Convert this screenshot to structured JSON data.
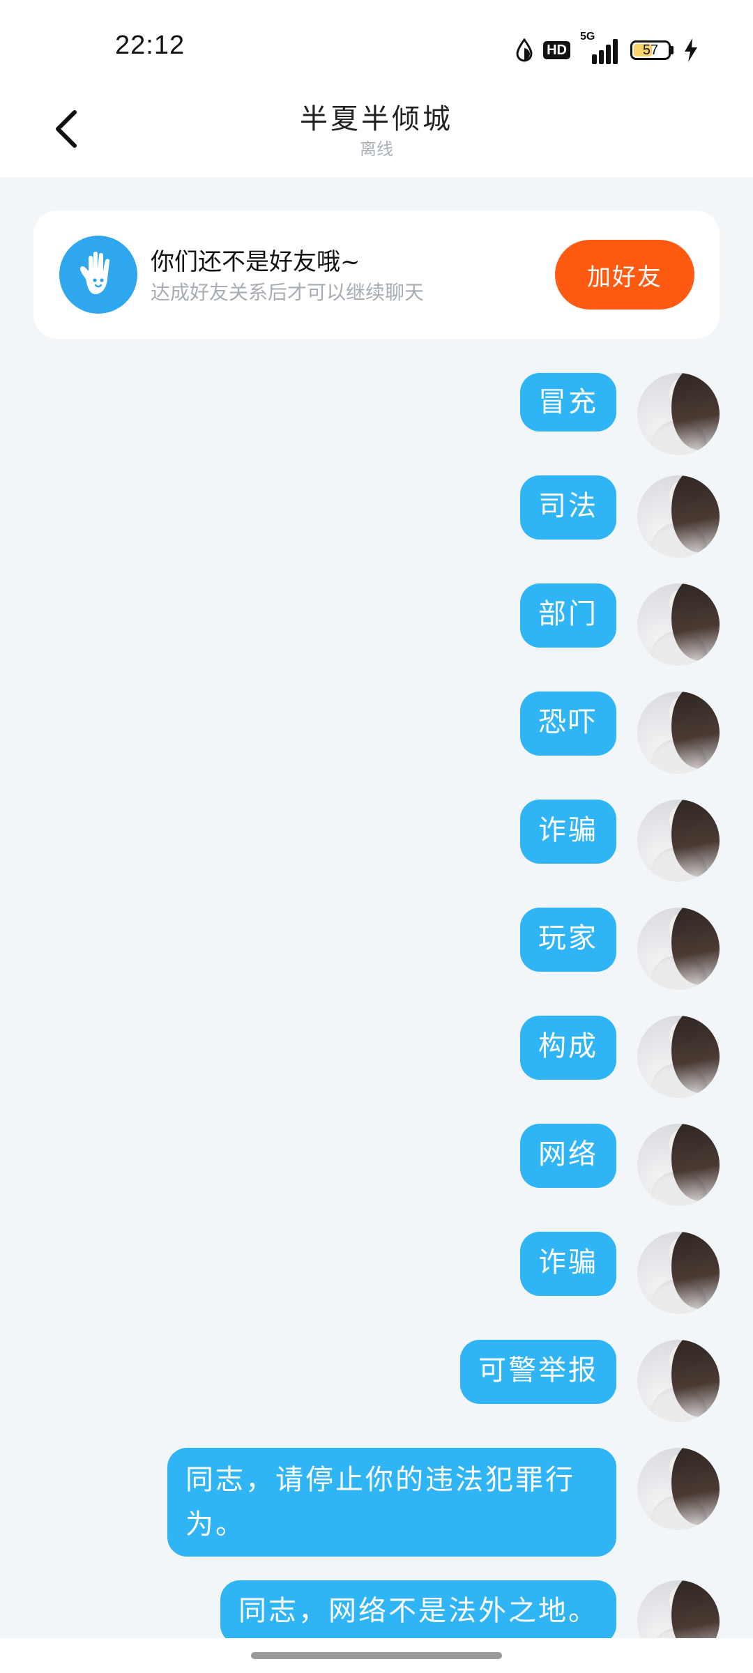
{
  "status_bar": {
    "time": "22:12",
    "hd": "HD",
    "network": "5G",
    "battery": "57",
    "battery_level": 0.57
  },
  "header": {
    "back_icon": "chevron-left-icon",
    "title": "半夏半倾城",
    "status": "离线"
  },
  "friend_card": {
    "icon": "waving-hand-icon",
    "title": "你们还不是好友哦~",
    "subtitle": "达成好友关系后才可以继续聊天",
    "button": "加好友",
    "button_color": "#ff5a12"
  },
  "messages": [
    {
      "text": "冒充"
    },
    {
      "text": "司法"
    },
    {
      "text": "部门"
    },
    {
      "text": "恐吓"
    },
    {
      "text": "诈骗"
    },
    {
      "text": "玩家"
    },
    {
      "text": "构成"
    },
    {
      "text": "网络"
    },
    {
      "text": "诈骗"
    },
    {
      "text": "可警举报"
    },
    {
      "text": "同志，请停止你的违法犯罪行为。"
    },
    {
      "text": "同志，网络不是法外之地。"
    }
  ],
  "colors": {
    "bubble": "#2fb4f5",
    "background": "#f3f6f9"
  }
}
